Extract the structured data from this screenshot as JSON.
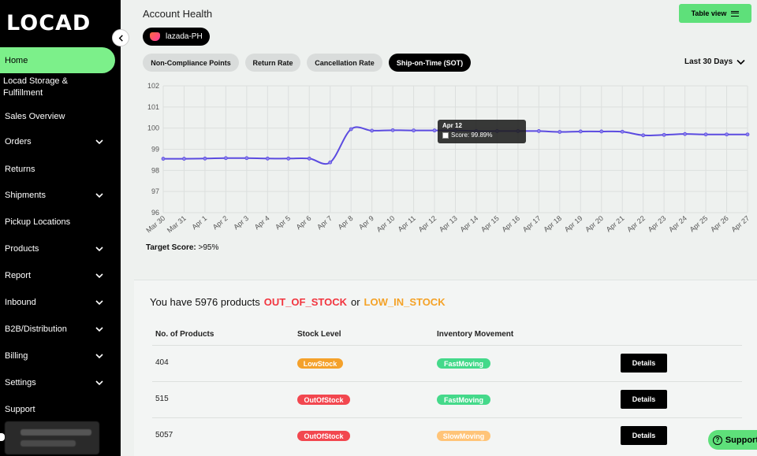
{
  "sidebar": {
    "logo": "LOCAD",
    "items": [
      {
        "label": "Home",
        "has_chevron": false
      },
      {
        "label": "Locad Storage & Fulfillment",
        "has_chevron": false
      },
      {
        "label": "Sales Overview",
        "has_chevron": false
      },
      {
        "label": "Orders",
        "has_chevron": true
      },
      {
        "label": "Returns",
        "has_chevron": false
      },
      {
        "label": "Shipments",
        "has_chevron": true
      },
      {
        "label": "Pickup Locations",
        "has_chevron": false
      },
      {
        "label": "Products",
        "has_chevron": true
      },
      {
        "label": "Report",
        "has_chevron": true
      },
      {
        "label": "Inbound",
        "has_chevron": true
      },
      {
        "label": "B2B/Distribution",
        "has_chevron": true
      },
      {
        "label": "Billing",
        "has_chevron": true
      },
      {
        "label": "Settings",
        "has_chevron": true
      },
      {
        "label": "Support",
        "has_chevron": false
      }
    ],
    "active_color": "#7cf08a"
  },
  "header": {
    "title": "Account Health",
    "table_view_label": "Table view",
    "store": "lazada-PH",
    "tabs": [
      {
        "label": "Non-Compliance Points",
        "active": false
      },
      {
        "label": "Return Rate",
        "active": false
      },
      {
        "label": "Cancellation Rate",
        "active": false
      },
      {
        "label": "Ship-on-Time (SOT)",
        "active": true
      }
    ],
    "range_label": "Last 30 Days"
  },
  "chart_data": {
    "type": "line",
    "x": [
      "Mar 30",
      "Mar 31",
      "Apr 1",
      "Apr 2",
      "Apr 3",
      "Apr 4",
      "Apr 5",
      "Apr 6",
      "Apr 7",
      "Apr 8",
      "Apr 9",
      "Apr 10",
      "Apr 11",
      "Apr 12",
      "Apr 13",
      "Apr 14",
      "Apr 15",
      "Apr 16",
      "Apr 17",
      "Apr 18",
      "Apr 19",
      "Apr 20",
      "Apr 21",
      "Apr 22",
      "Apr 23",
      "Apr 24",
      "Apr 25",
      "Apr 26",
      "Apr 27"
    ],
    "series": [
      {
        "values": [
          98.55,
          98.55,
          98.56,
          98.58,
          98.58,
          98.56,
          98.56,
          98.56,
          98.38,
          99.95,
          99.88,
          99.9,
          99.89,
          99.89,
          99.89,
          99.86,
          99.86,
          99.86,
          99.86,
          99.82,
          99.84,
          99.84,
          99.83,
          99.66,
          99.68,
          99.72,
          99.7,
          99.7,
          99.7
        ],
        "color": "#5b4be0"
      }
    ],
    "yticks": [
      "96",
      "97",
      "98",
      "99",
      "100",
      "101",
      "102"
    ],
    "ylim": [
      96,
      102
    ],
    "grid": true,
    "tooltip": {
      "label": "Apr 12",
      "text": "Score: 99.89%"
    }
  },
  "target": {
    "label": "Target Score:",
    "value": ">95%"
  },
  "inventory": {
    "alert_prefix": "You have 5976 products",
    "out_label": "OUT_OF_STOCK",
    "or_label": "or",
    "low_label": "LOW_IN_STOCK",
    "columns": [
      "No. of Products",
      "Stock Level",
      "Inventory Movement"
    ],
    "rows": [
      {
        "count": "404",
        "stock": "LowStock",
        "stock_type": "low",
        "movement": "FastMoving",
        "movement_type": "fast",
        "action": "Details"
      },
      {
        "count": "515",
        "stock": "OutOfStock",
        "stock_type": "out",
        "movement": "FastMoving",
        "movement_type": "fast",
        "action": "Details"
      },
      {
        "count": "5057",
        "stock": "OutOfStock",
        "stock_type": "out",
        "movement": "SlowMoving",
        "movement_type": "slow",
        "action": "Details"
      }
    ]
  },
  "support_label": "Support"
}
